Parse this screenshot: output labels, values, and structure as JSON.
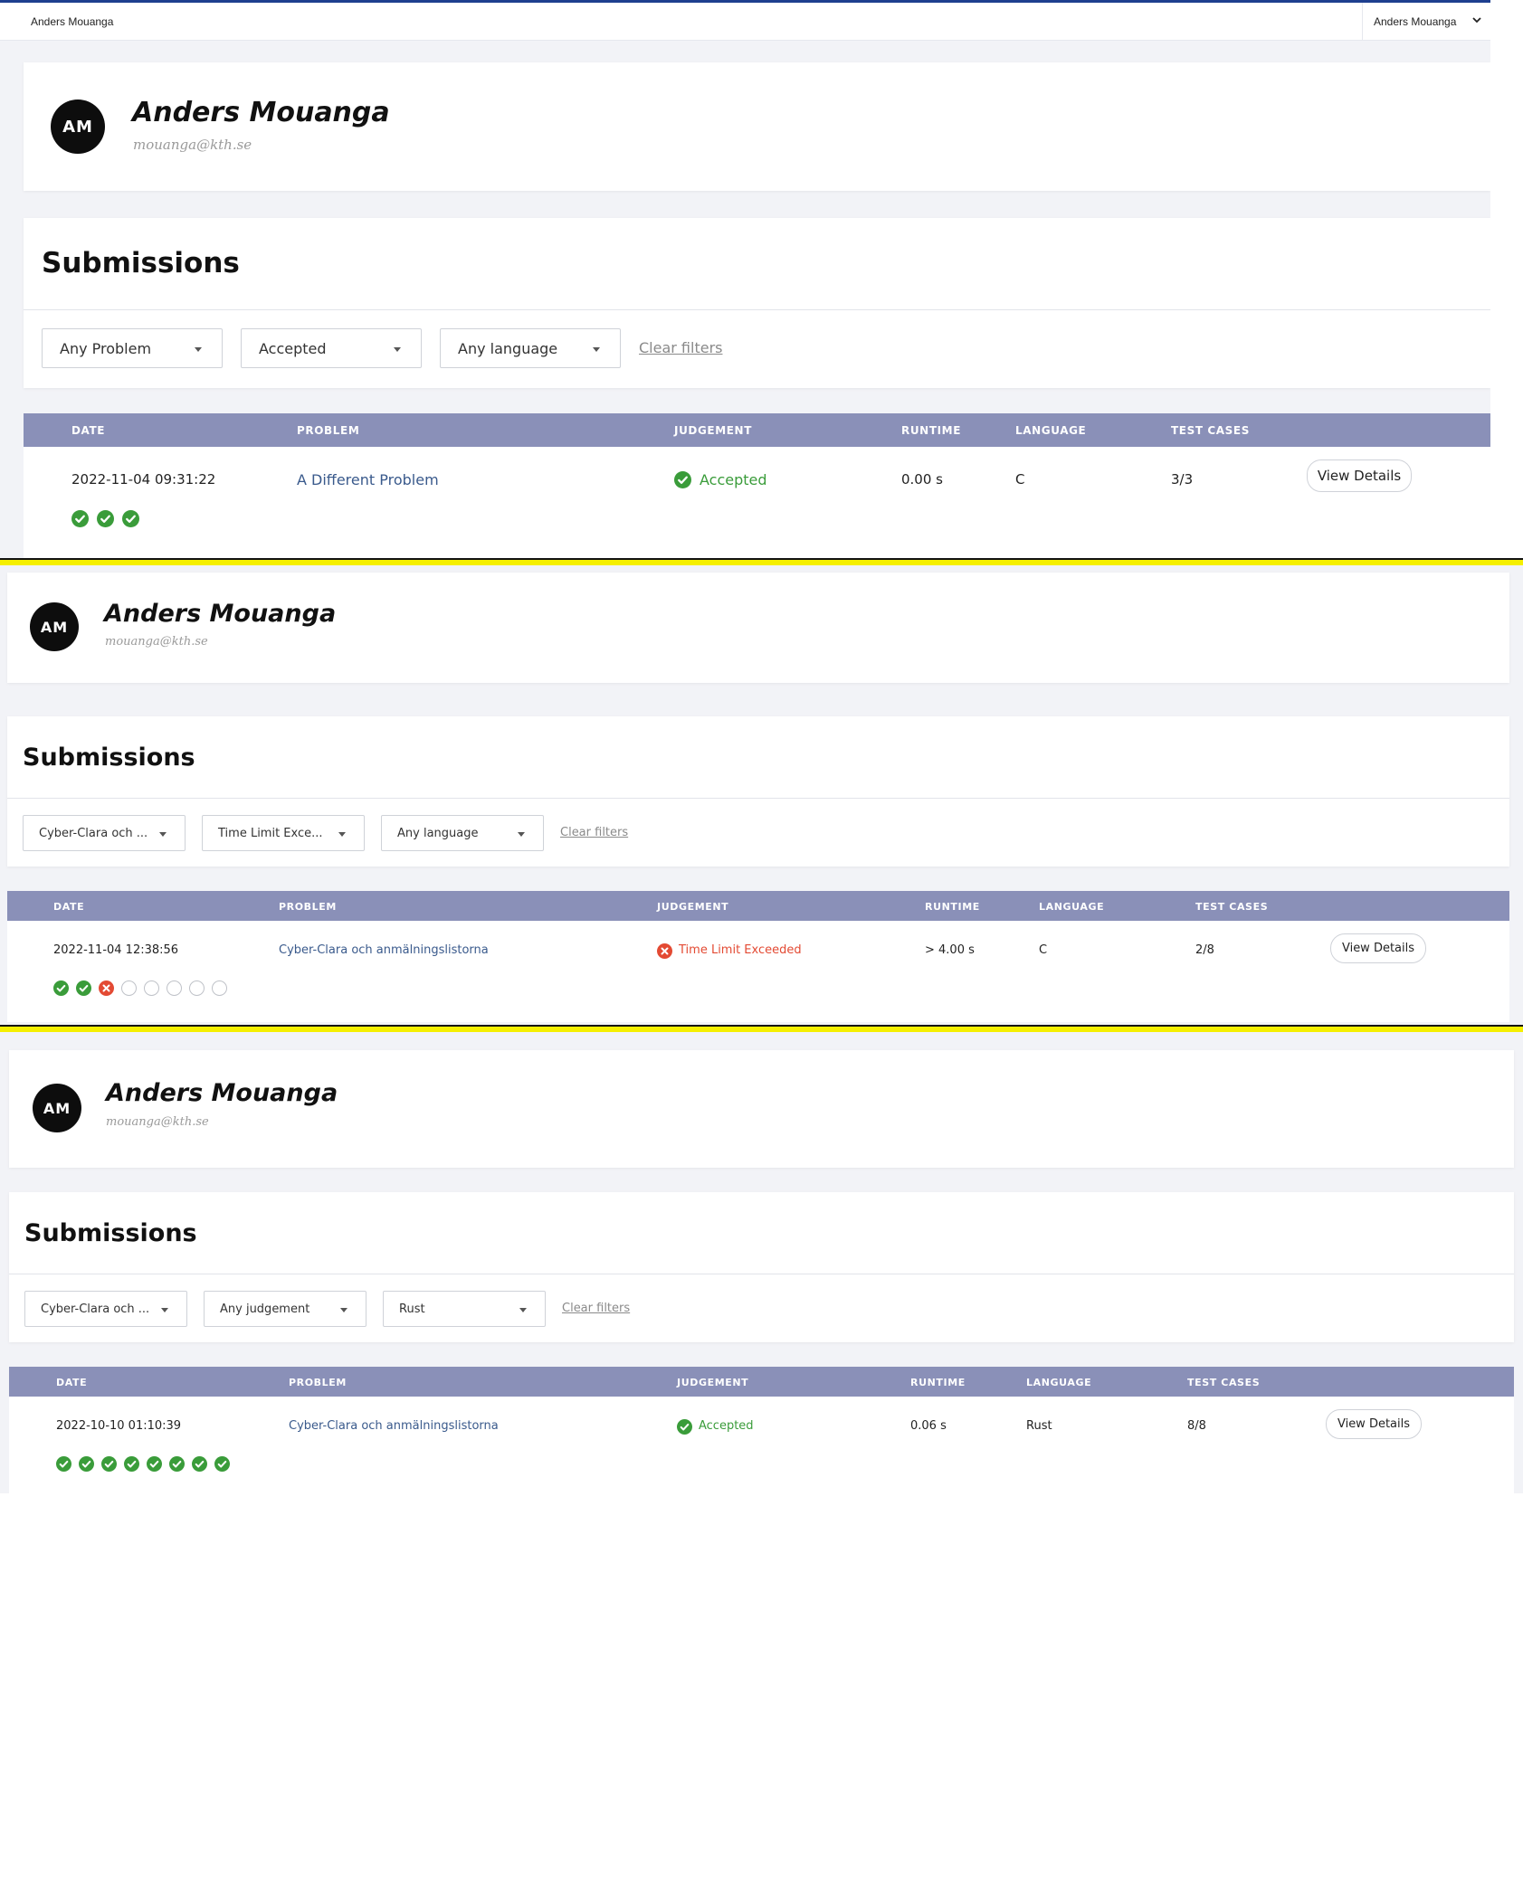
{
  "topbar": {
    "left_name": "Anders Mouanga",
    "user_menu_label": "Anders Mouanga"
  },
  "colors": {
    "header_accent": "#1e3f8f",
    "table_header": "#8a90b8",
    "accepted": "#3a9c3a",
    "error": "#e34a33",
    "separator_highlight": "#f5ef00"
  },
  "panels": [
    {
      "profile": {
        "initials": "AM",
        "name": "Anders Mouanga",
        "email": "mouanga@kth.se"
      },
      "submissions_title": "Submissions",
      "filters": {
        "problem": "Any Problem",
        "judgement": "Accepted",
        "language": "Any language",
        "clear_label": "Clear filters"
      },
      "table": {
        "headers": [
          "DATE",
          "PROBLEM",
          "JUDGEMENT",
          "RUNTIME",
          "LANGUAGE",
          "TEST CASES"
        ],
        "rows": [
          {
            "date": "2022-11-04 09:31:22",
            "problem": "A Different Problem",
            "judgement": "Accepted",
            "judgement_status": "accepted",
            "runtime": "0.00 s",
            "language": "C",
            "test_cases": "3/3",
            "view_label": "View Details",
            "test_results": [
              "pass",
              "pass",
              "pass"
            ]
          }
        ]
      }
    },
    {
      "profile": {
        "initials": "AM",
        "name": "Anders Mouanga",
        "email": "mouanga@kth.se"
      },
      "submissions_title": "Submissions",
      "filters": {
        "problem": "Cyber-Clara och ...",
        "judgement": "Time Limit Exce...",
        "language": "Any language",
        "clear_label": "Clear filters"
      },
      "table": {
        "headers": [
          "DATE",
          "PROBLEM",
          "JUDGEMENT",
          "RUNTIME",
          "LANGUAGE",
          "TEST CASES"
        ],
        "rows": [
          {
            "date": "2022-11-04 12:38:56",
            "problem": "Cyber-Clara och anmälningslistorna",
            "judgement": "Time Limit Exceeded",
            "judgement_status": "error",
            "runtime": "> 4.00 s",
            "language": "C",
            "test_cases": "2/8",
            "view_label": "View Details",
            "test_results": [
              "pass",
              "pass",
              "fail",
              "none",
              "none",
              "none",
              "none",
              "none"
            ]
          }
        ]
      }
    },
    {
      "profile": {
        "initials": "AM",
        "name": "Anders Mouanga",
        "email": "mouanga@kth.se"
      },
      "submissions_title": "Submissions",
      "filters": {
        "problem": "Cyber-Clara och ...",
        "judgement": "Any judgement",
        "language": "Rust",
        "clear_label": "Clear filters"
      },
      "table": {
        "headers": [
          "DATE",
          "PROBLEM",
          "JUDGEMENT",
          "RUNTIME",
          "LANGUAGE",
          "TEST CASES"
        ],
        "rows": [
          {
            "date": "2022-10-10 01:10:39",
            "problem": "Cyber-Clara och anmälningslistorna",
            "judgement": "Accepted",
            "judgement_status": "accepted",
            "runtime": "0.06 s",
            "language": "Rust",
            "test_cases": "8/8",
            "view_label": "View Details",
            "test_results": [
              "pass",
              "pass",
              "pass",
              "pass",
              "pass",
              "pass",
              "pass",
              "pass"
            ]
          }
        ]
      }
    }
  ]
}
